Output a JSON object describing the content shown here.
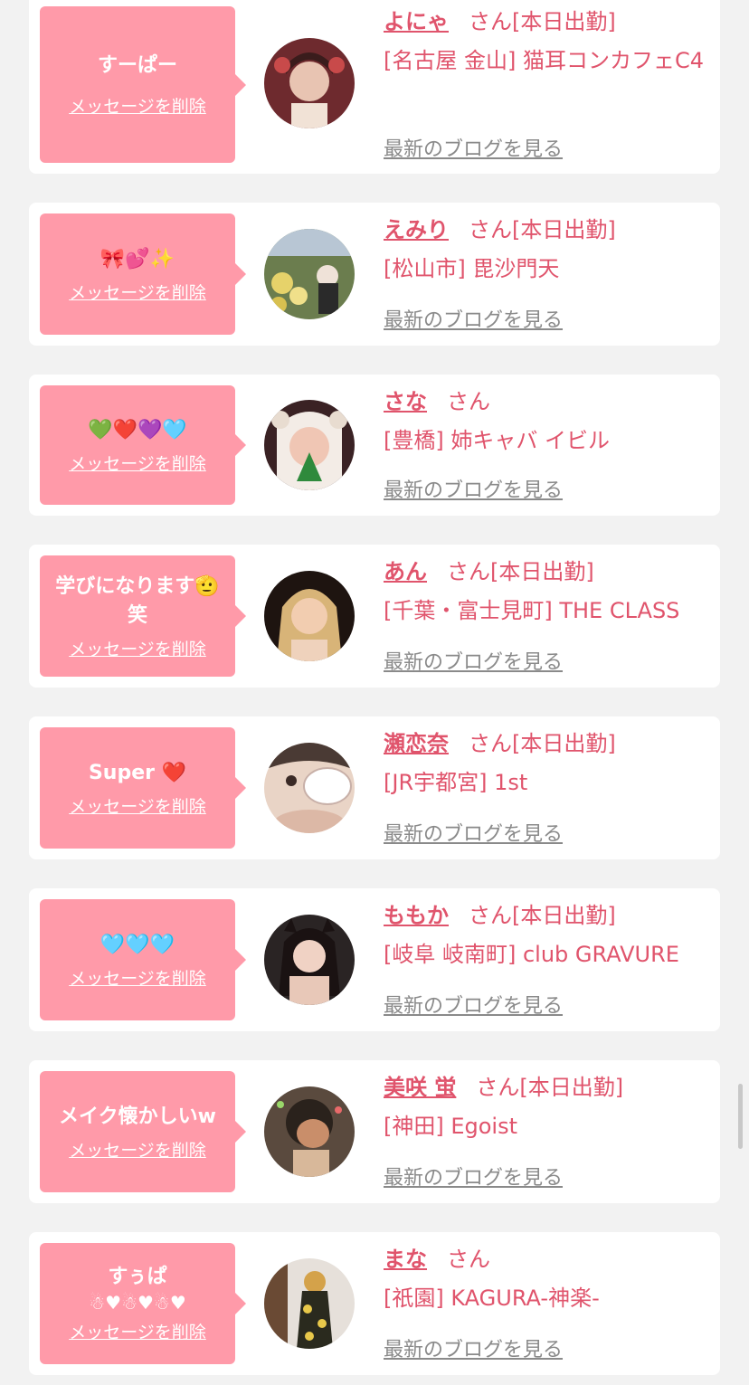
{
  "colors": {
    "accent": "#e0546c",
    "bubble": "#ff9aa9",
    "background": "#f2f2f2",
    "link_gray": "#8a8a8a"
  },
  "entries": [
    {
      "message_lines": [
        "すーぱー"
      ],
      "delete_label": "メッセージを削除",
      "name": "よにゃ",
      "suffix": "さん[本日出勤]",
      "shop": "[名古屋 金山] 猫耳コンカフェC4",
      "blog_label": "最新のブログを見る"
    },
    {
      "message_lines": [
        "🎀💕✨"
      ],
      "delete_label": "メッセージを削除",
      "name": "えみり",
      "suffix": "さん[本日出勤]",
      "shop": "[松山市] 毘沙門天",
      "blog_label": "最新のブログを見る"
    },
    {
      "message_lines": [
        "💚❤️💜🩵"
      ],
      "delete_label": "メッセージを削除",
      "name": "さな",
      "suffix": "さん",
      "shop": "[豊橋] 姉キャバ イビル",
      "blog_label": "最新のブログを見る"
    },
    {
      "message_lines": [
        "学びになります🫡",
        "笑"
      ],
      "delete_label": "メッセージを削除",
      "name": "あん",
      "suffix": "さん[本日出勤]",
      "shop": "[千葉・富士見町] THE CLASS",
      "blog_label": "最新のブログを見る"
    },
    {
      "message_lines": [
        "Super ❤️"
      ],
      "delete_label": "メッセージを削除",
      "name": "瀬恋奈",
      "suffix": "さん[本日出勤]",
      "shop": "[JR宇都宮] 1st",
      "blog_label": "最新のブログを見る"
    },
    {
      "message_lines": [
        "🩵🩵🩵"
      ],
      "delete_label": "メッセージを削除",
      "name": "ももか",
      "suffix": "さん[本日出勤]",
      "shop": "[岐阜 岐南町] club GRAVURE",
      "blog_label": "最新のブログを見る"
    },
    {
      "message_lines": [
        "メイク懐かしいw"
      ],
      "delete_label": "メッセージを削除",
      "name": "美咲 蛍",
      "suffix": "さん[本日出勤]",
      "shop": "[神田] Egoist",
      "blog_label": "最新のブログを見る"
    },
    {
      "message_lines": [
        "すぅぱ",
        "☃︎♥☃︎♥☃︎♥"
      ],
      "delete_label": "メッセージを削除",
      "name": "まな",
      "suffix": "さん",
      "shop": "[祇園] KAGURA-神楽-",
      "blog_label": "最新のブログを見る"
    }
  ]
}
